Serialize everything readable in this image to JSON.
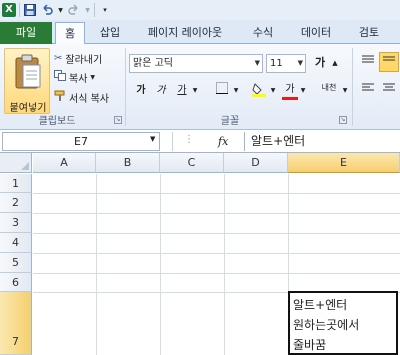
{
  "qat": {
    "icons": [
      "excel-logo",
      "save-icon",
      "undo-icon",
      "redo-icon",
      "customize-icon"
    ]
  },
  "tabs": {
    "file": "파일",
    "items": [
      "홈",
      "삽입",
      "페이지 레이아웃",
      "수식",
      "데이터",
      "검토"
    ]
  },
  "ribbon": {
    "clipboard": {
      "paste": "붙여넣기",
      "cut": "잘라내기",
      "copy": "복사",
      "format_painter": "서식 복사",
      "label": "클립보드"
    },
    "font": {
      "name": "맑은 고딕",
      "size": "11",
      "grow": "가",
      "bold": "가",
      "italic": "가",
      "underline": "가",
      "font_color": "가",
      "phonetic": "내천",
      "label": "글꼴"
    }
  },
  "formula_bar": {
    "name_box": "E7",
    "fx": "fx",
    "value": "알트+엔터"
  },
  "grid": {
    "columns": [
      "A",
      "B",
      "C",
      "D",
      "E"
    ],
    "rows": [
      "1",
      "2",
      "3",
      "4",
      "5",
      "6",
      "7"
    ],
    "selected_column": "E",
    "selected_row": "7",
    "active_cell_lines": [
      "알트+엔터",
      "원하는곳에서",
      "줄바꿈"
    ]
  }
}
